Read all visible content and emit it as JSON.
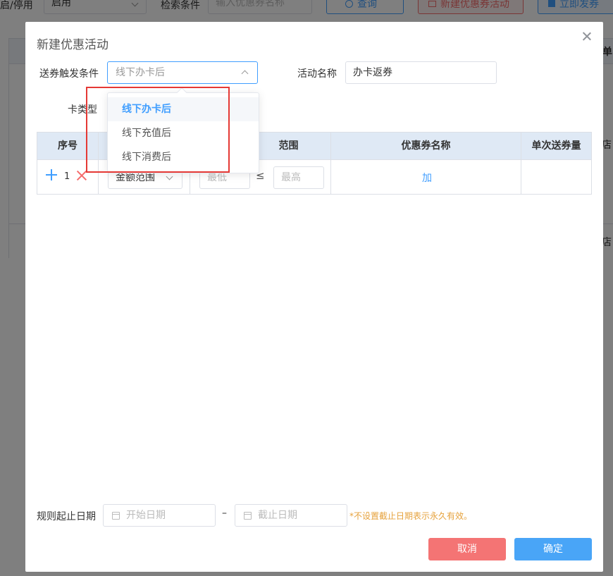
{
  "background": {
    "status_label": "启/停用",
    "status_value": "启用",
    "search_label": "检索条件",
    "search_placeholder": "输入优惠券名称",
    "query_button": "查询",
    "new_button": "新建优惠券活动",
    "send_button": "立即发券",
    "header_fragment": "单",
    "cell_fragment_1": "店",
    "cell_fragment_2": "店"
  },
  "dialog": {
    "title": "新建优惠活动",
    "trigger_label": "送券触发条件",
    "trigger_value": "线下办卡后",
    "name_label": "活动名称",
    "name_value": "办卡返券",
    "card_type_label": "卡类型",
    "dropdown_options": [
      "线下办卡后",
      "线下充值后",
      "线下消费后"
    ],
    "table": {
      "headers": [
        "序号",
        "",
        "范围",
        "优惠券名称",
        "单次送券量"
      ],
      "row": {
        "index": "1",
        "range_type": "金额范围",
        "min_placeholder": "最低",
        "le_sign": "≤",
        "max_placeholder": "最高",
        "add_link": "加"
      }
    },
    "date_label": "规则起止日期",
    "start_placeholder": "开始日期",
    "dash": "–",
    "end_placeholder": "截止日期",
    "date_hint": "*不设置截止日期表示永久有效。",
    "cancel_button": "取消",
    "confirm_button": "确定"
  },
  "colors": {
    "primary": "#409eff",
    "danger": "#f47474",
    "confirm": "#49a5f7",
    "hint": "#e6a23c",
    "highlight": "#e53935"
  }
}
